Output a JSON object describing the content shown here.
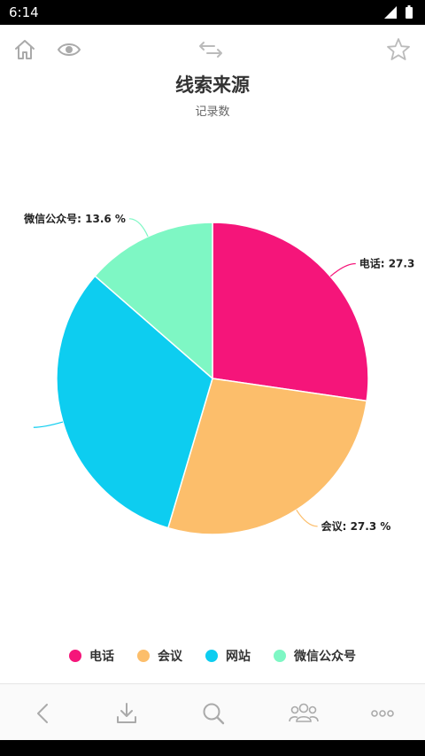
{
  "status_bar": {
    "time": "6:14"
  },
  "header": {
    "title": "线索来源",
    "subtitle": "记录数"
  },
  "icons": {
    "home": "home-icon",
    "view": "eye-icon",
    "switch": "swap-arrows-icon",
    "favorite": "star-icon",
    "back": "chevron-left-icon",
    "download": "download-icon",
    "search": "search-icon",
    "users": "users-icon",
    "more": "more-dots-icon"
  },
  "chart_data": {
    "type": "pie",
    "title": "线索来源",
    "subtitle": "记录数",
    "categories": [
      "电话",
      "会议",
      "网站",
      "微信公众号"
    ],
    "values": [
      27.3,
      27.3,
      31.8,
      13.6
    ],
    "unit": "%",
    "colors": [
      "#f5157a",
      "#fcbe6b",
      "#0dcdf0",
      "#7ef7c4"
    ],
    "slice_labels": [
      "电话: 27.3",
      "会议: 27.3 %",
      "",
      "微信公众号: 13.6 %"
    ],
    "legend": [
      "电话",
      "会议",
      "网站",
      "微信公众号"
    ],
    "legend_position": "bottom"
  }
}
